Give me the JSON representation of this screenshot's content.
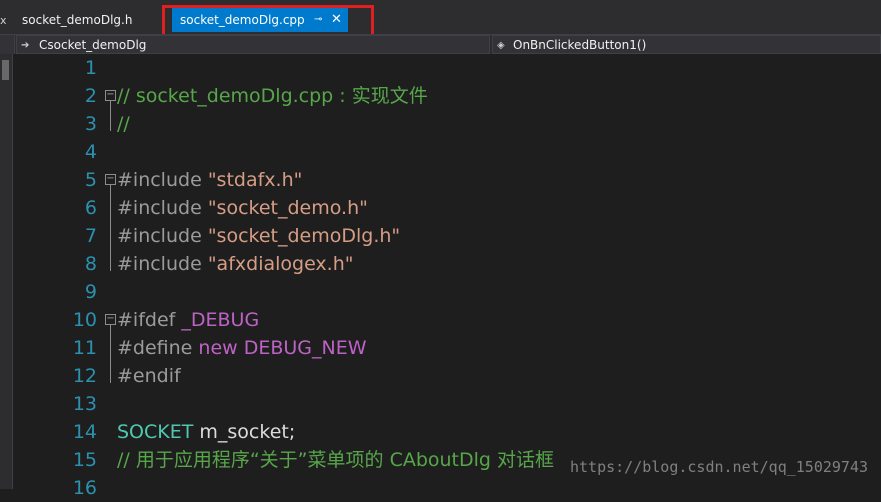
{
  "tabs": {
    "first_label": "socket_demoDlg.h",
    "active_label": "socket_demoDlg.cpp",
    "pin_glyph": "⊸",
    "close_glyph": "✕",
    "left_glyph": "x"
  },
  "navbar": {
    "class_dropdown": "Csocket_demoDlg",
    "member_dropdown": "OnBnClickedButton1()"
  },
  "code": {
    "lines": [
      {
        "n": "1"
      },
      {
        "n": "2",
        "tokens": [
          {
            "t": "// socket_demoDlg.cpp : 实现文件",
            "c": "cm"
          }
        ]
      },
      {
        "n": "3",
        "tokens": [
          {
            "t": "//",
            "c": "cm"
          }
        ]
      },
      {
        "n": "4"
      },
      {
        "n": "5",
        "tokens": [
          {
            "t": "#include ",
            "c": "pp"
          },
          {
            "t": "\"stdafx.h\"",
            "c": "str"
          }
        ]
      },
      {
        "n": "6",
        "tokens": [
          {
            "t": "#include ",
            "c": "pp"
          },
          {
            "t": "\"socket_demo.h\"",
            "c": "str"
          }
        ]
      },
      {
        "n": "7",
        "tokens": [
          {
            "t": "#include ",
            "c": "pp"
          },
          {
            "t": "\"socket_demoDlg.h\"",
            "c": "str"
          }
        ]
      },
      {
        "n": "8",
        "tokens": [
          {
            "t": "#include ",
            "c": "pp"
          },
          {
            "t": "\"afxdialogex.h\"",
            "c": "str"
          }
        ]
      },
      {
        "n": "9"
      },
      {
        "n": "10",
        "tokens": [
          {
            "t": "#ifdef ",
            "c": "pp"
          },
          {
            "t": "_DEBUG",
            "c": "mac"
          }
        ]
      },
      {
        "n": "11",
        "tokens": [
          {
            "t": "#define ",
            "c": "pp"
          },
          {
            "t": "new DEBUG_NEW",
            "c": "mac"
          }
        ]
      },
      {
        "n": "12",
        "tokens": [
          {
            "t": "#endif",
            "c": "pp"
          }
        ]
      },
      {
        "n": "13"
      },
      {
        "n": "14",
        "tokens": [
          {
            "t": "SOCKET",
            "c": "typ"
          },
          {
            "t": " m_socket;",
            "c": "id"
          }
        ]
      },
      {
        "n": "15",
        "tokens": [
          {
            "t": "// 用于应用程序“关于”菜单项的 CAboutDlg 对话框",
            "c": "cm"
          }
        ]
      },
      {
        "n": "16"
      }
    ]
  },
  "watermark": "https://blog.csdn.net/qq_15029743"
}
